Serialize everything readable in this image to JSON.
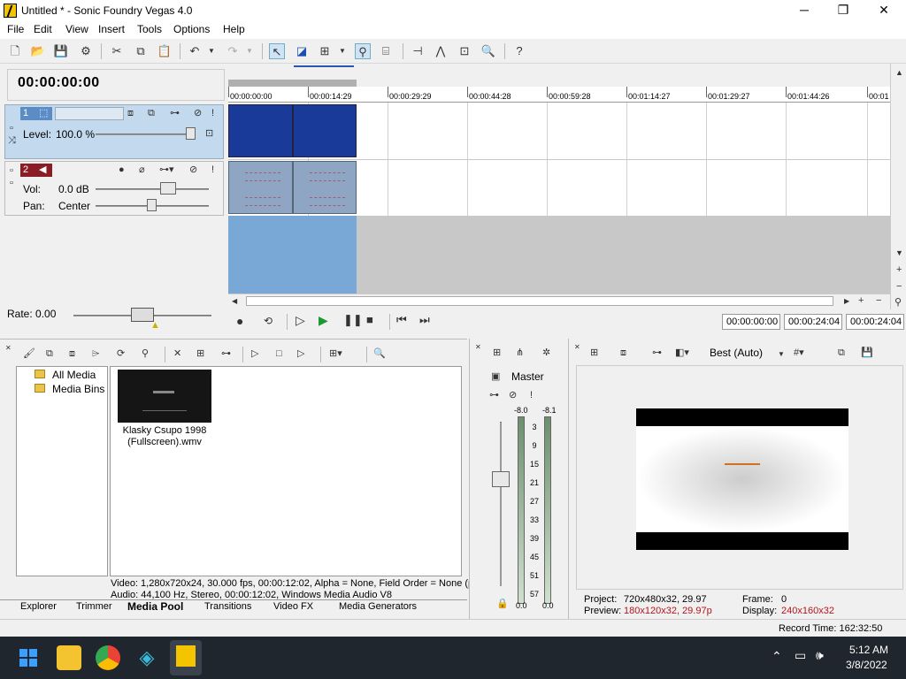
{
  "window": {
    "title": "Untitled * - Sonic Foundry Vegas 4.0",
    "minimize": "─",
    "maximize": "❐",
    "close": "✕"
  },
  "menu": [
    "File",
    "Edit",
    "View",
    "Insert",
    "Tools",
    "Options",
    "Help"
  ],
  "timecode": "00:00:00:00",
  "ruler": {
    "ticks": [
      "00:00:00:00",
      "00:00:14:29",
      "00:00:29:29",
      "00:00:44:28",
      "00:00:59:28",
      "00:01:14:27",
      "00:01:29:27",
      "00:01:44:26",
      "00:01"
    ]
  },
  "video_track": {
    "number": "1",
    "level_label": "Level:",
    "level_value": "100.0 %"
  },
  "audio_track": {
    "number": "2",
    "vol_label": "Vol:",
    "vol_value": "0.0 dB",
    "pan_label": "Pan:",
    "pan_value": "Center"
  },
  "rate": {
    "label": "Rate: 0.00"
  },
  "transport": {
    "cursor": "00:00:00:00",
    "end": "00:00:24:04",
    "length": "00:00:24:04"
  },
  "explorer": {
    "tree": [
      "All Media",
      "Media Bins"
    ],
    "media_item": "Klasky Csupo 1998 (Fullscreen).wmv",
    "video_info": "Video: 1,280x720x24, 30.000 fps, 00:00:12:02, Alpha = None, Field Order = None (p",
    "audio_info": "Audio: 44,100 Hz, Stereo, 00:00:12:02, Windows Media Audio V8"
  },
  "tabs": [
    "Explorer",
    "Trimmer",
    "Media Pool",
    "Transitions",
    "Video FX",
    "Media Generators"
  ],
  "active_tab": "Media Pool",
  "mixer": {
    "title": "Master",
    "peak_left": "-8.0",
    "peak_right": "-8.1",
    "scale": [
      "3",
      "9",
      "15",
      "21",
      "27",
      "33",
      "39",
      "45",
      "51",
      "57"
    ],
    "bottom_left": "0.0",
    "bottom_right": "0.0"
  },
  "preview": {
    "quality": "Best (Auto)",
    "project_label": "Project:",
    "project": "720x480x32, 29.97",
    "preview_label": "Preview:",
    "preview": "180x120x32, 29.97p",
    "frame_label": "Frame:",
    "frame": "0",
    "display_label": "Display:",
    "display": "240x160x32"
  },
  "status": {
    "record_time": "Record Time: 162:32:50"
  },
  "taskbar": {
    "time": "5:12 AM",
    "date": "3/8/2022"
  },
  "colors": {
    "track_selected": "#c3d9ee",
    "accent_red": "#b3151c",
    "taskbar": "#20262e"
  }
}
